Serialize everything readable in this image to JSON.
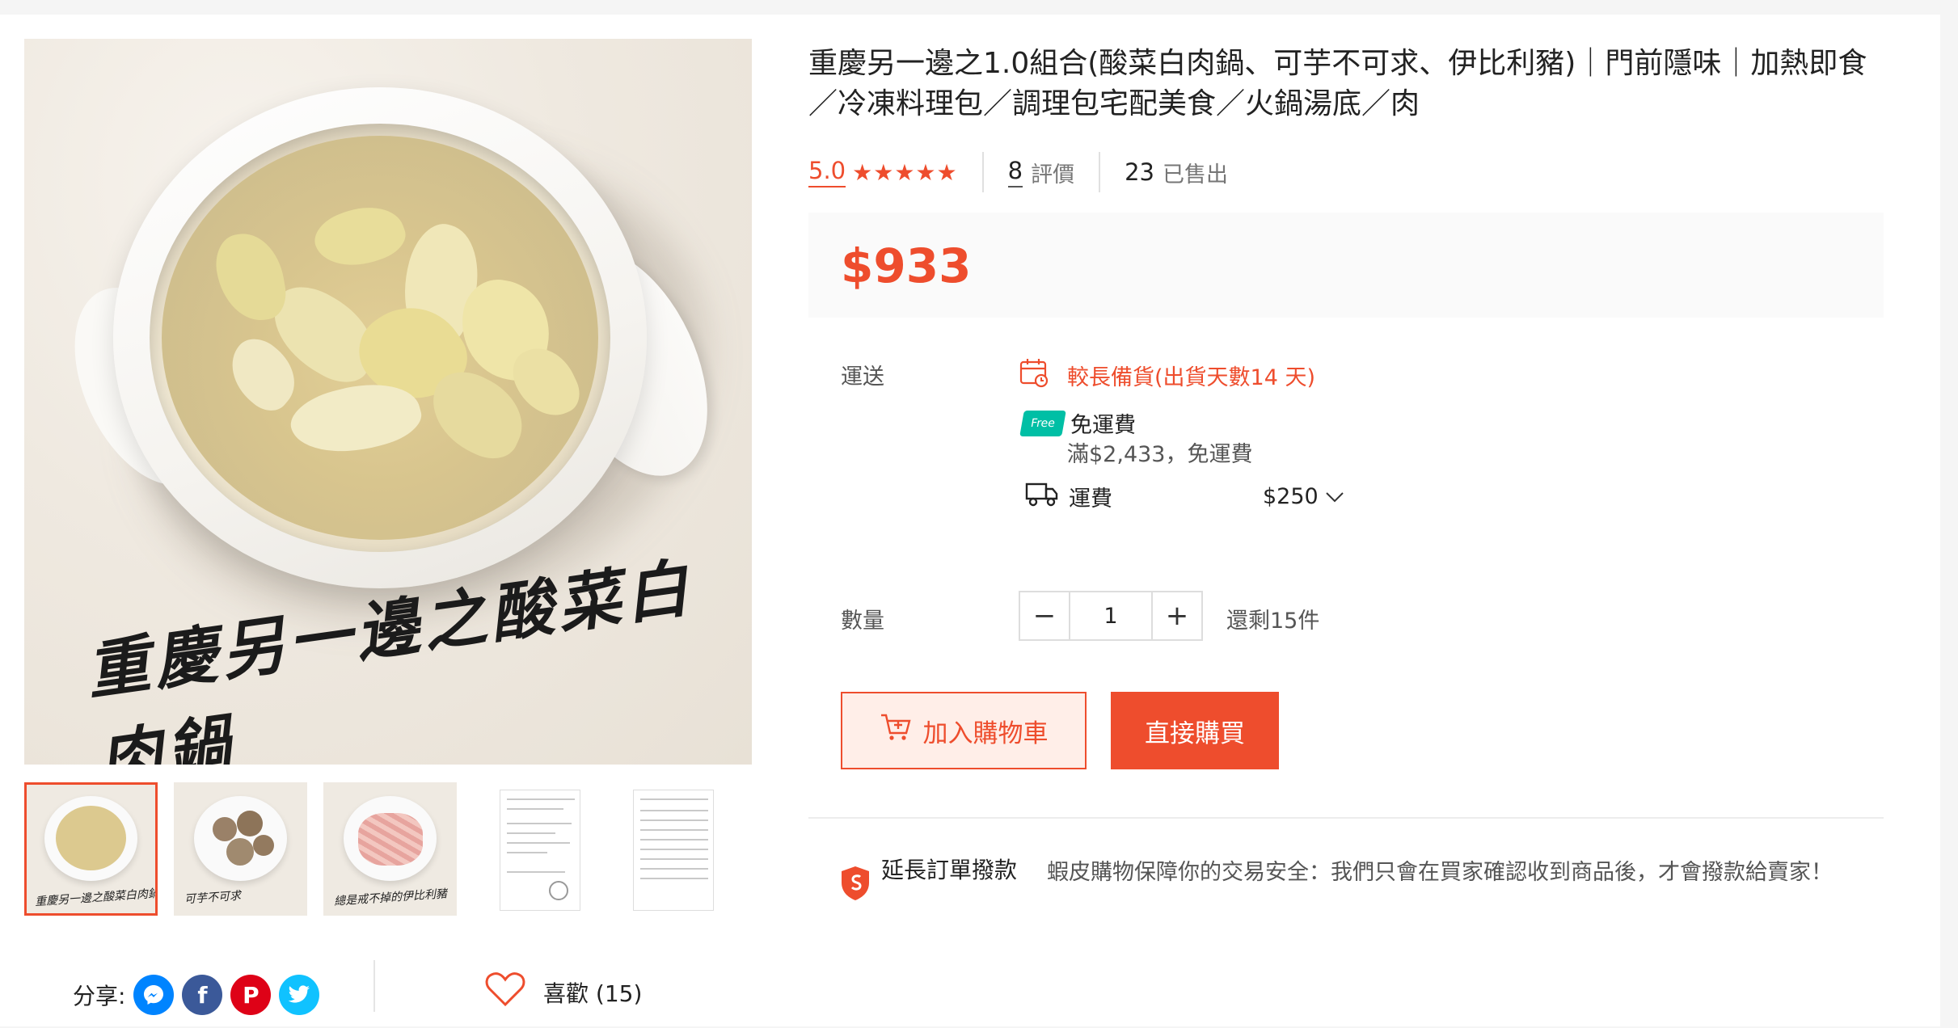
{
  "product": {
    "title": "重慶另一邊之1.0組合(酸菜白肉鍋、可芋不可求、伊比利豬)｜門前隱味｜加熱即食／冷凍料理包／調理包宅配美食／火鍋湯底／肉",
    "image_caption": "重慶另一邊之酸菜白肉鍋",
    "rating": "5.0",
    "stars": "★★★★★",
    "reviews_count": "8",
    "reviews_label": "評價",
    "sold_count": "23",
    "sold_label": "已售出",
    "price": "$933"
  },
  "thumbnails": [
    {
      "caption": "重慶另一邊之酸菜白肉鍋",
      "active": true
    },
    {
      "caption": "可芋不可求",
      "active": false
    },
    {
      "caption": "總是戒不掉的伊比利豬",
      "active": false
    },
    {
      "caption": "",
      "active": false
    },
    {
      "caption": "",
      "active": false
    }
  ],
  "shipping": {
    "label": "運送",
    "preorder": "較長備貨(出貨天數14 天)",
    "free_badge": "Free",
    "free_title": "免運費",
    "free_condition": "滿$2,433，免運費",
    "fee_label": "運費",
    "fee_value": "$250",
    "icons": [
      "calendar-icon",
      "free-shipping-icon",
      "truck-icon",
      "chevron-down-icon"
    ]
  },
  "quantity": {
    "label": "數量",
    "value": "1",
    "minus": "−",
    "plus": "+",
    "stock": "還剩15件"
  },
  "actions": {
    "add_to_cart": "加入購物車",
    "buy_now": "直接購買"
  },
  "guarantee": {
    "title": "延長訂單撥款",
    "text": "蝦皮購物保障你的交易安全：我們只會在買家確認收到商品後，才會撥款給賣家！"
  },
  "share": {
    "label": "分享:",
    "networks": [
      {
        "name": "messenger",
        "color": "#0084ff"
      },
      {
        "name": "facebook",
        "color": "#3b5999"
      },
      {
        "name": "pinterest",
        "color": "#de0217"
      },
      {
        "name": "twitter",
        "color": "#10c2ff"
      }
    ],
    "facebook_glyph": "f",
    "pinterest_glyph": "P"
  },
  "like": {
    "label": "喜歡 (15)"
  },
  "colors": {
    "accent": "#ee4d2d",
    "free_badge": "#00bfa5"
  }
}
